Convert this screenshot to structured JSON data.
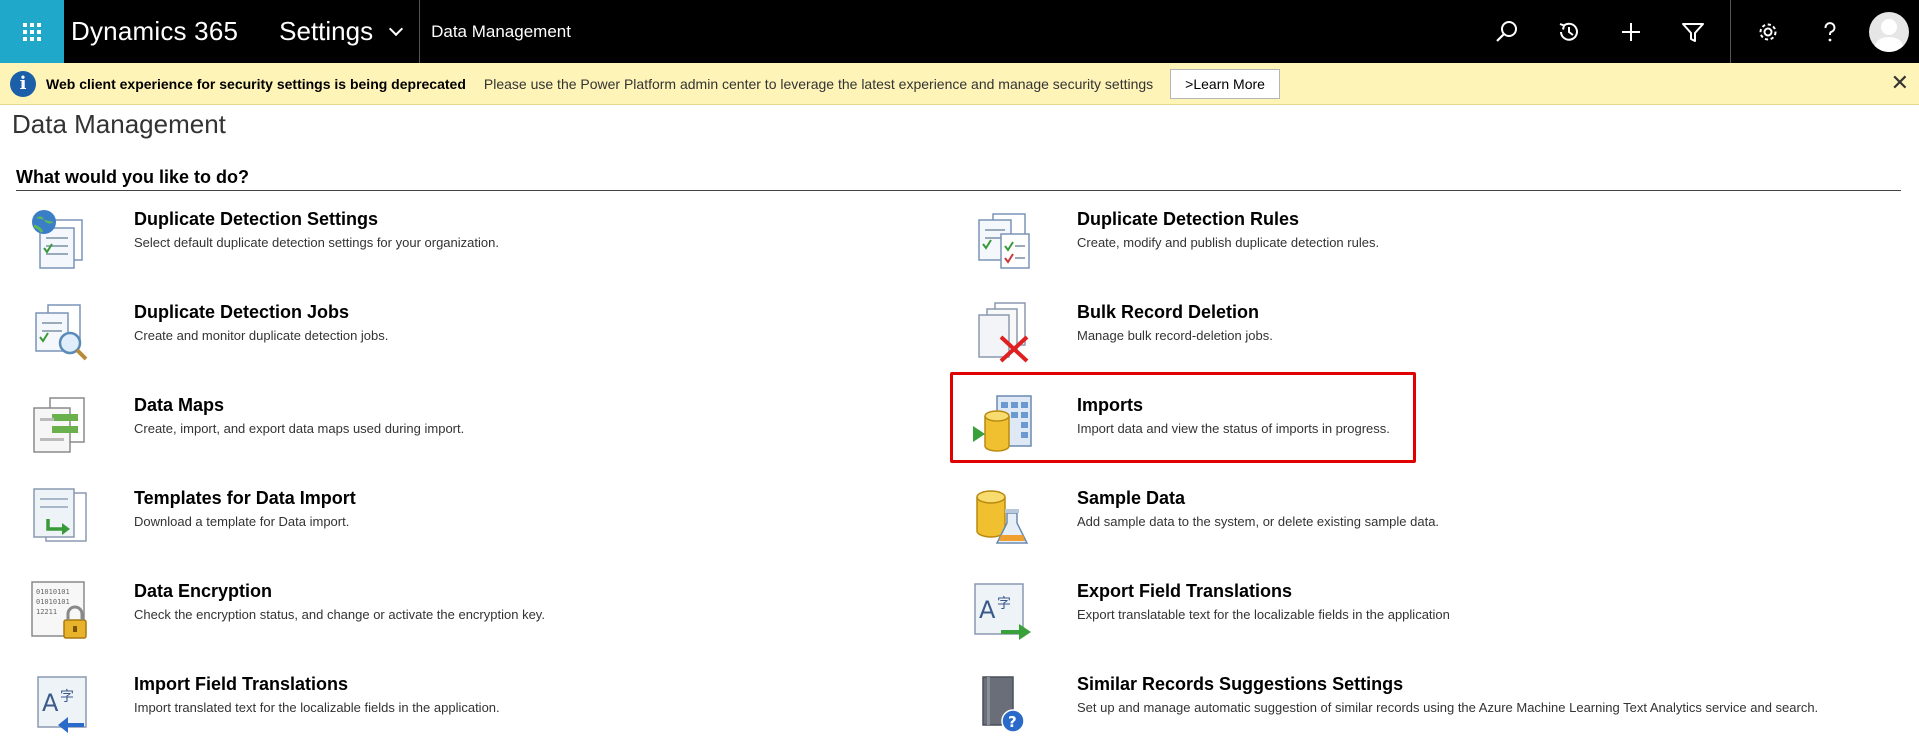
{
  "topbar": {
    "brand": "Dynamics 365",
    "area": "Settings",
    "breadcrumb": "Data Management"
  },
  "notice": {
    "title": "Web client experience for security settings is being deprecated",
    "message": "Please use the Power Platform admin center to leverage the latest experience and manage security settings",
    "button": ">Learn More",
    "close": "✕"
  },
  "page": {
    "title": "Data Management",
    "section": "What would you like to do?"
  },
  "items": [
    {
      "title": "Duplicate Detection Settings",
      "desc": "Select default duplicate detection settings for your organization."
    },
    {
      "title": "Duplicate Detection Rules",
      "desc": "Create, modify and publish duplicate detection rules."
    },
    {
      "title": "Duplicate Detection Jobs",
      "desc": "Create and monitor duplicate detection jobs."
    },
    {
      "title": "Bulk Record Deletion",
      "desc": "Manage bulk record-deletion jobs."
    },
    {
      "title": "Data Maps",
      "desc": "Create, import, and export data maps used during import."
    },
    {
      "title": "Imports",
      "desc": "Import data and view the status of imports in progress."
    },
    {
      "title": "Templates for Data Import",
      "desc": "Download a template for Data import."
    },
    {
      "title": "Sample Data",
      "desc": "Add sample data to the system, or delete existing sample data."
    },
    {
      "title": "Data Encryption",
      "desc": "Check the encryption status, and change or activate the encryption key."
    },
    {
      "title": "Export Field Translations",
      "desc": "Export translatable text for the localizable fields in the application"
    },
    {
      "title": "Import Field Translations",
      "desc": "Import translated text for the localizable fields in the application."
    },
    {
      "title": "Similar Records Suggestions Settings",
      "desc": "Set up and manage automatic suggestion of similar records using the Azure Machine Learning Text Analytics service and search."
    }
  ],
  "icons": {
    "encryption_digits": "01010101\n01010101\n12211"
  },
  "colors": {
    "waffle": "#1fa8c9",
    "notice_bg": "#fff4b8",
    "info_icon": "#1a5fa8",
    "highlight": "#e00000"
  }
}
